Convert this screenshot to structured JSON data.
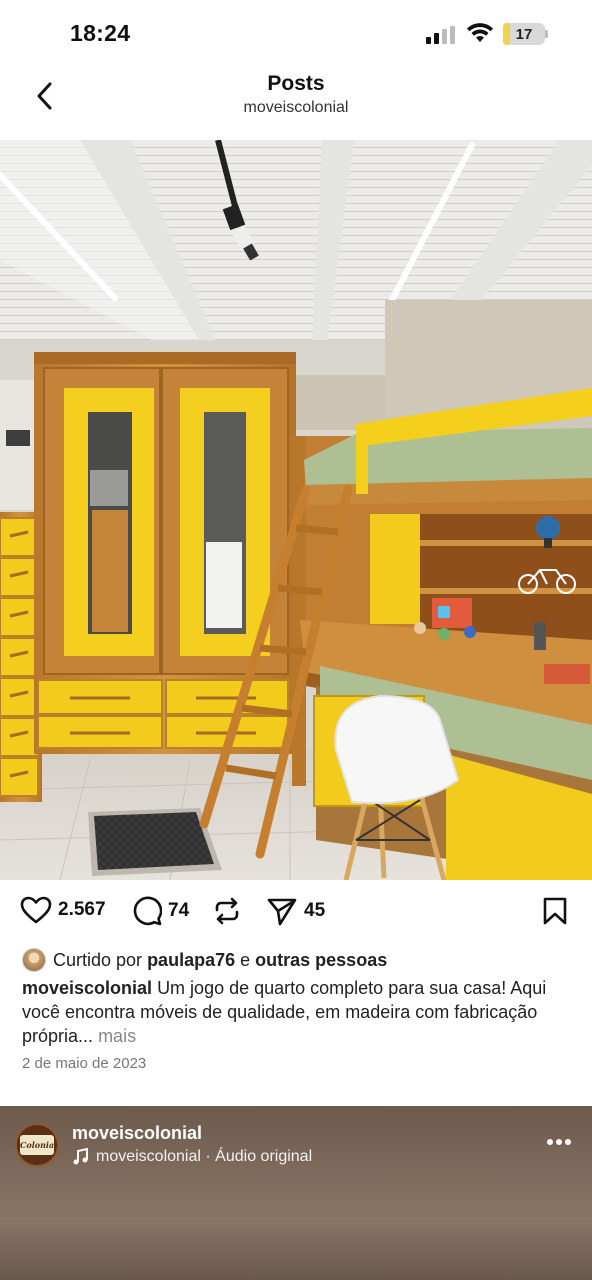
{
  "status_bar": {
    "time": "18:24",
    "battery": "17"
  },
  "header": {
    "title": "Posts",
    "subtitle": "moveiscolonial"
  },
  "post": {
    "likes_count": "2.567",
    "comments_count": "74",
    "shares_count": "45",
    "liked_by_prefix": "Curtido por",
    "liked_by_user": "paulapa76",
    "liked_by_connector": "e",
    "liked_by_others": "outras pessoas",
    "caption_username": "moveiscolonial",
    "caption_text": "Um jogo de quarto completo para sua casa! Aqui você encontra móveis de qualidade, em madeira com fabricação própria...",
    "more_label": "mais",
    "date": "2 de maio de 2023"
  },
  "next_post": {
    "username": "moveiscolonial",
    "audio_user": "moveiscolonial",
    "audio_separator": "·",
    "audio_label": "Áudio original",
    "avatar_text": "Colonial"
  },
  "colors": {
    "furniture_yellow": "#f2cb1c",
    "wood": "#c98a34"
  }
}
